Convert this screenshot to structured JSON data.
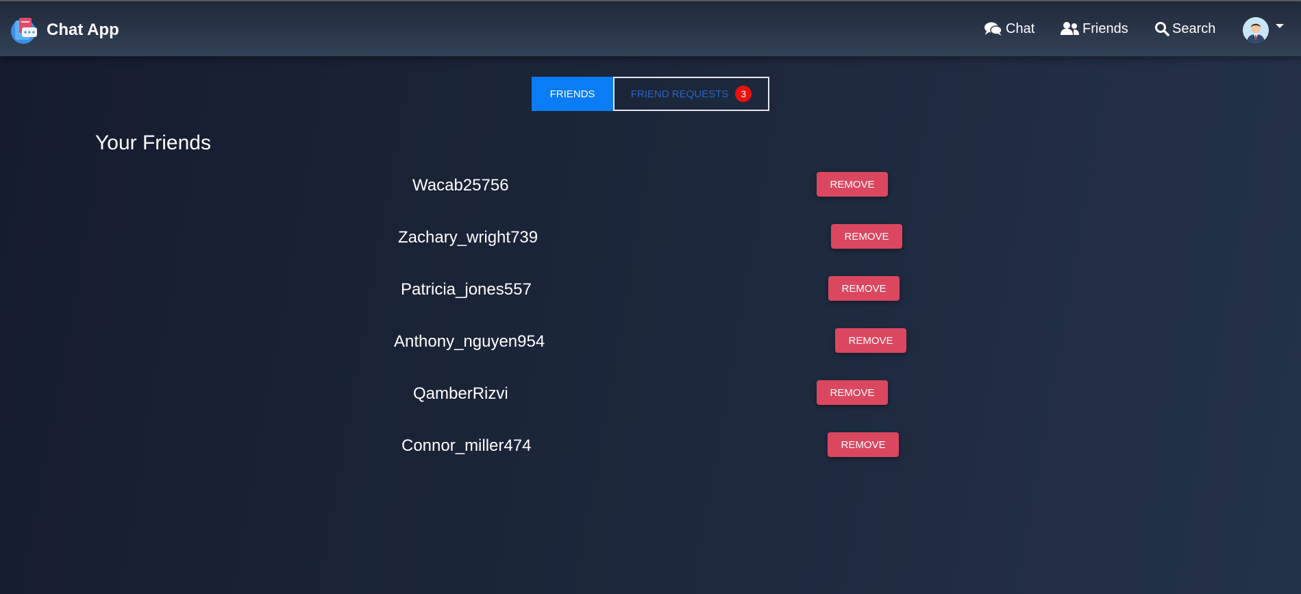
{
  "app": {
    "name": "Chat App"
  },
  "nav": {
    "chat_label": "Chat",
    "friends_label": "Friends",
    "search_label": "Search"
  },
  "tabs": {
    "friends_label": "FRIENDS",
    "requests_label": "FRIEND REQUESTS",
    "requests_count": "3",
    "active": "FRIENDS"
  },
  "friends": {
    "title": "Your Friends",
    "remove_label": "REMOVE",
    "items": [
      {
        "name": "Wacab25756"
      },
      {
        "name": "Zachary_wright739"
      },
      {
        "name": "Patricia_jones557"
      },
      {
        "name": "Anthony_nguyen954"
      },
      {
        "name": "QamberRizvi"
      },
      {
        "name": "Connor_miller474"
      }
    ]
  },
  "colors": {
    "accent": "#0a7cf5",
    "danger": "#dc4760",
    "badge": "#e8120f"
  }
}
